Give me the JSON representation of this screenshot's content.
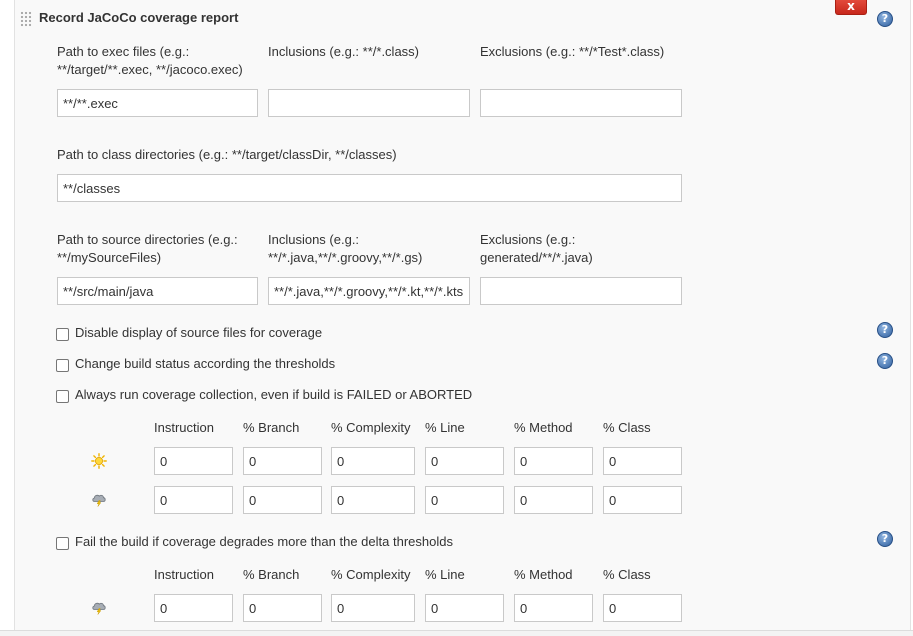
{
  "section": {
    "title": "Record JaCoCo coverage report",
    "delete_label": "x",
    "help_glyph": "?"
  },
  "exec": {
    "path_label_line1": "Path to exec files (e.g.:",
    "path_label_line2": "**/target/**.exec, **/jacoco.exec)",
    "path_value": "**/**.exec",
    "inclusions_label": "Inclusions (e.g.: **/*.class)",
    "inclusions_value": "",
    "exclusions_label": "Exclusions (e.g.: **/*Test*.class)",
    "exclusions_value": ""
  },
  "classes": {
    "label": "Path to class directories (e.g.: **/target/classDir, **/classes)",
    "value": "**/classes"
  },
  "sources": {
    "path_label_line1": "Path to source directories (e.g.:",
    "path_label_line2": "**/mySourceFiles)",
    "path_value": "**/src/main/java",
    "inclusions_label_line1": "Inclusions (e.g.:",
    "inclusions_label_line2": "**/*.java,**/*.groovy,**/*.gs)",
    "inclusions_value": "**/*.java,**/*.groovy,**/*.kt,**/*.kts",
    "exclusions_label_line1": "Exclusions (e.g.:",
    "exclusions_label_line2": "generated/**/*.java)",
    "exclusions_value": ""
  },
  "options": {
    "disable_source_display": {
      "label": "Disable display of source files for coverage",
      "checked": false
    },
    "change_build_status": {
      "label": "Change build status according the thresholds",
      "checked": false
    },
    "always_run": {
      "label": "Always run coverage collection, even if build is FAILED or ABORTED",
      "checked": false
    },
    "fail_on_delta": {
      "label": "Fail the build if coverage degrades more than the delta thresholds",
      "checked": false
    }
  },
  "thresholds": {
    "headers": [
      "Instruction",
      "% Branch",
      "% Complexity",
      "% Line",
      "% Method",
      "% Class"
    ],
    "healthy_icon": "sun-icon",
    "unhealthy_icon": "storm-icon",
    "healthy_values": [
      "0",
      "0",
      "0",
      "0",
      "0",
      "0"
    ],
    "unhealthy_values": [
      "0",
      "0",
      "0",
      "0",
      "0",
      "0"
    ]
  },
  "delta_thresholds": {
    "headers": [
      "Instruction",
      "% Branch",
      "% Complexity",
      "% Line",
      "% Method",
      "% Class"
    ],
    "icon": "storm-icon",
    "values": [
      "0",
      "0",
      "0",
      "0",
      "0",
      "0"
    ]
  },
  "colors": {
    "help_blue": "#2f5f9e",
    "delete_red": "#d2382a",
    "panel_bg": "#f9f9f9"
  }
}
